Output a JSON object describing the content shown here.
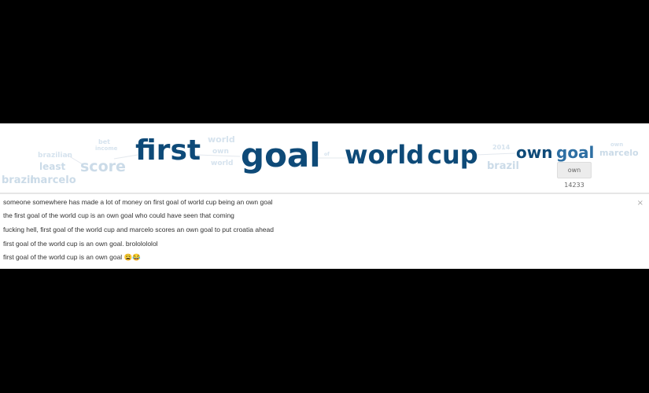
{
  "cloud": {
    "words": {
      "brazilian": "brazilian",
      "least": "least",
      "brazil": "brazil",
      "marcelo_left": "marcelo",
      "bet": "bet",
      "income": "income",
      "score": "score",
      "first": "first",
      "world_small_1": "world",
      "own_small": "own",
      "world_small_2": "world",
      "goal_main": "goal",
      "of_small": "of",
      "world_main": "world",
      "cup_main": "cup",
      "year": "2014",
      "brazil_right": "brazil",
      "own_main": "own",
      "goal_right": "goal",
      "marcelo_right": "marcelo",
      "own_small_right": "own"
    },
    "count_badge": "own 14233"
  },
  "tweets": {
    "close_label": "×",
    "items": [
      "someone somewhere has made a lot of money on first goal of world cup being an own goal",
      "the first goal of the world cup is an own goal who could have seen that coming",
      "fucking hell, first goal of the world cup and marcelo scores an own goal to put croatia ahead",
      "first goal of the world cup is an own goal. brololololol",
      "first goal of the world cup is an own goal 😩😂"
    ]
  }
}
